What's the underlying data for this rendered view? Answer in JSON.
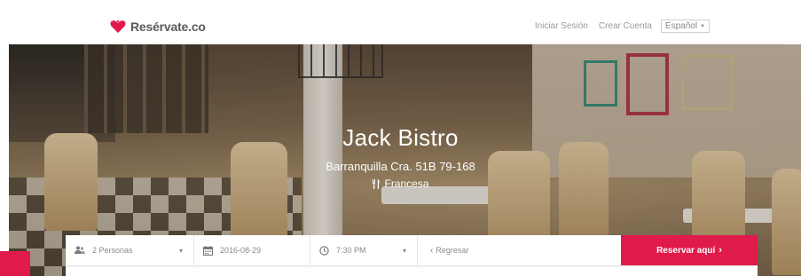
{
  "brand": {
    "name": "Resérvate.co",
    "accent": "#e11a4c"
  },
  "nav": {
    "login": "Iniciar Sesión",
    "signup": "Crear Cuenta",
    "language": "Español"
  },
  "restaurant": {
    "name": "Jack Bistro",
    "address": "Barranquilla Cra. 51B 79-168",
    "cuisine": "Francesa"
  },
  "booking": {
    "people": "2 Personas",
    "date": "2016-08-29",
    "time": "7:30 PM",
    "back": "Regresar",
    "reserve": "Reservar aquí",
    "reserve_arrow": "›"
  },
  "icons": {
    "people": "people-icon",
    "calendar": "calendar-icon",
    "clock": "clock-icon",
    "fork_knife": "fork-knife-icon",
    "logo": "heart-logo-icon"
  }
}
